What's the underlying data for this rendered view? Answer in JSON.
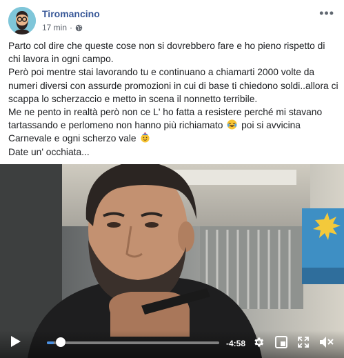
{
  "post": {
    "author": "Tiromancino",
    "time": "17 min",
    "separator": "·",
    "paragraphs": [
      "Parto col dire che queste cose non si dovrebbero fare e ho pieno rispetto di chi lavora in ogni campo.",
      "Però poi mentre stai lavorando tu e continuano a chiamarti 2000 volte da numeri diversi con assurde promozioni in cui di base ti chiedono soldi..allora ci scappa lo scherzaccio e metto in scena il nonnetto terribile.",
      "Me ne pento in realtà però non ce L' ho fatta a resistere perché mi stavano tartassando e perlomeno non hanno più richiamato",
      "poi si avvicina Carnevale e ogni scherzo vale",
      "Date un' occhiata..."
    ],
    "emojis": [
      "laughing-crying-emoji",
      "party-face-emoji"
    ]
  },
  "video": {
    "remaining_time": "-4:58",
    "progress": 0.04
  },
  "colors": {
    "author_blue": "#385898",
    "meta_gray": "#616770",
    "text": "#1c1e21"
  }
}
